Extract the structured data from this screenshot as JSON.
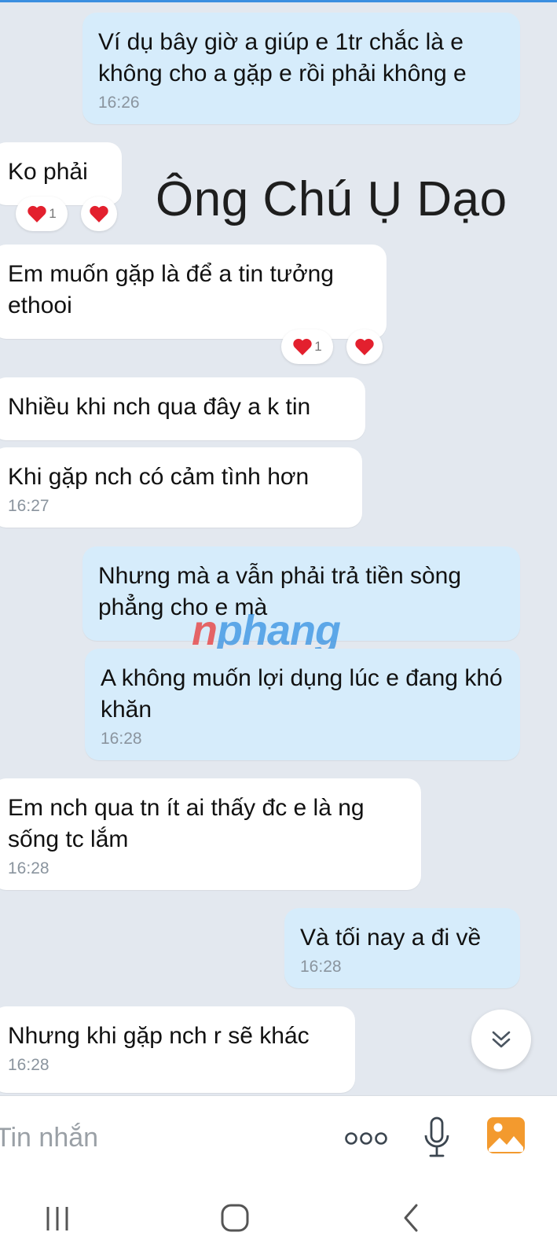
{
  "overlay_title": "Ông Chú Ụ Dạo",
  "watermark": {
    "first_letter": "n",
    "rest": "phang"
  },
  "messages": [
    {
      "side": "out",
      "text": "Ví dụ bây giờ a giúp e 1tr chắc là e không cho a gặp e rồi phải không e",
      "time": "16:26"
    },
    {
      "side": "in",
      "text": "Ko phải",
      "reaction_count": "1"
    },
    {
      "side": "in",
      "text": "Em muốn gặp là để a tin tưởng ethooi",
      "reaction_count": "1"
    },
    {
      "side": "in",
      "text": "Nhiều khi nch qua đây a k tin"
    },
    {
      "side": "in",
      "text": "Khi gặp nch có cảm tình hơn",
      "time": "16:27"
    },
    {
      "side": "out",
      "text": "Nhưng mà a vẫn phải trả tiền sòng phẳng cho e mà"
    },
    {
      "side": "out",
      "text": "A không muốn lợi dụng lúc e đang khó khăn",
      "time": "16:28"
    },
    {
      "side": "in",
      "text": "Em nch qua tn ít ai thấy đc e là ng sống tc lắm",
      "time": "16:28"
    },
    {
      "side": "out",
      "text": "Và tối nay a đi về",
      "time": "16:28"
    },
    {
      "side": "in",
      "text": "Nhưng khi gặp nch r sẽ khác",
      "time": "16:28"
    }
  ],
  "input": {
    "placeholder": "Tin nhắn"
  },
  "icons": {
    "heart_color": "#e3202e",
    "accent_color": "#f39a2e",
    "more": "more-dots-icon",
    "mic": "microphone-icon",
    "image": "image-gallery-icon",
    "scroll_down": "double-chevron-down-icon",
    "nav_recent": "recent-apps-icon",
    "nav_home": "home-icon",
    "nav_back": "back-icon"
  }
}
